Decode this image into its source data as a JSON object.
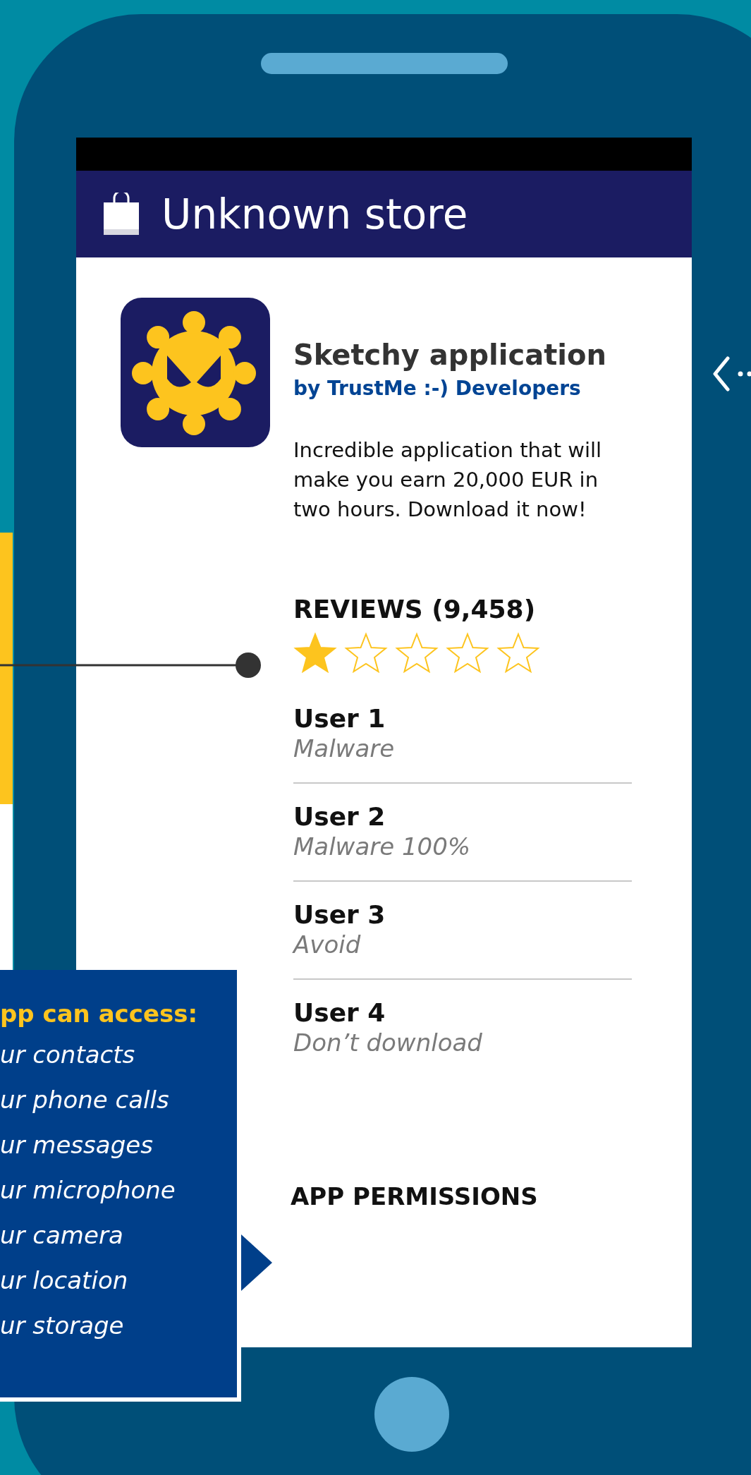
{
  "store": {
    "title": "Unknown store"
  },
  "app": {
    "name": "Sketchy application",
    "developer": "by TrustMe :-) Developers",
    "description": "Incredible application that will make you earn 20,000 EUR in two hours. Download it now!"
  },
  "reviews": {
    "heading": "REVIEWS (9,458)",
    "stars": 1,
    "items": [
      {
        "user": "User 1",
        "comment": "Malware"
      },
      {
        "user": "User 2",
        "comment": "Malware 100%"
      },
      {
        "user": "User 3",
        "comment": "Avoid"
      },
      {
        "user": "User 4",
        "comment": "Don’t download"
      }
    ]
  },
  "permissions_link": "APP PERMISSIONS",
  "callout": {
    "heading": "pp can access:",
    "items": [
      "ur contacts",
      "ur phone calls",
      "ur messages",
      "ur microphone",
      "ur camera",
      "ur location",
      "ur storage"
    ]
  }
}
